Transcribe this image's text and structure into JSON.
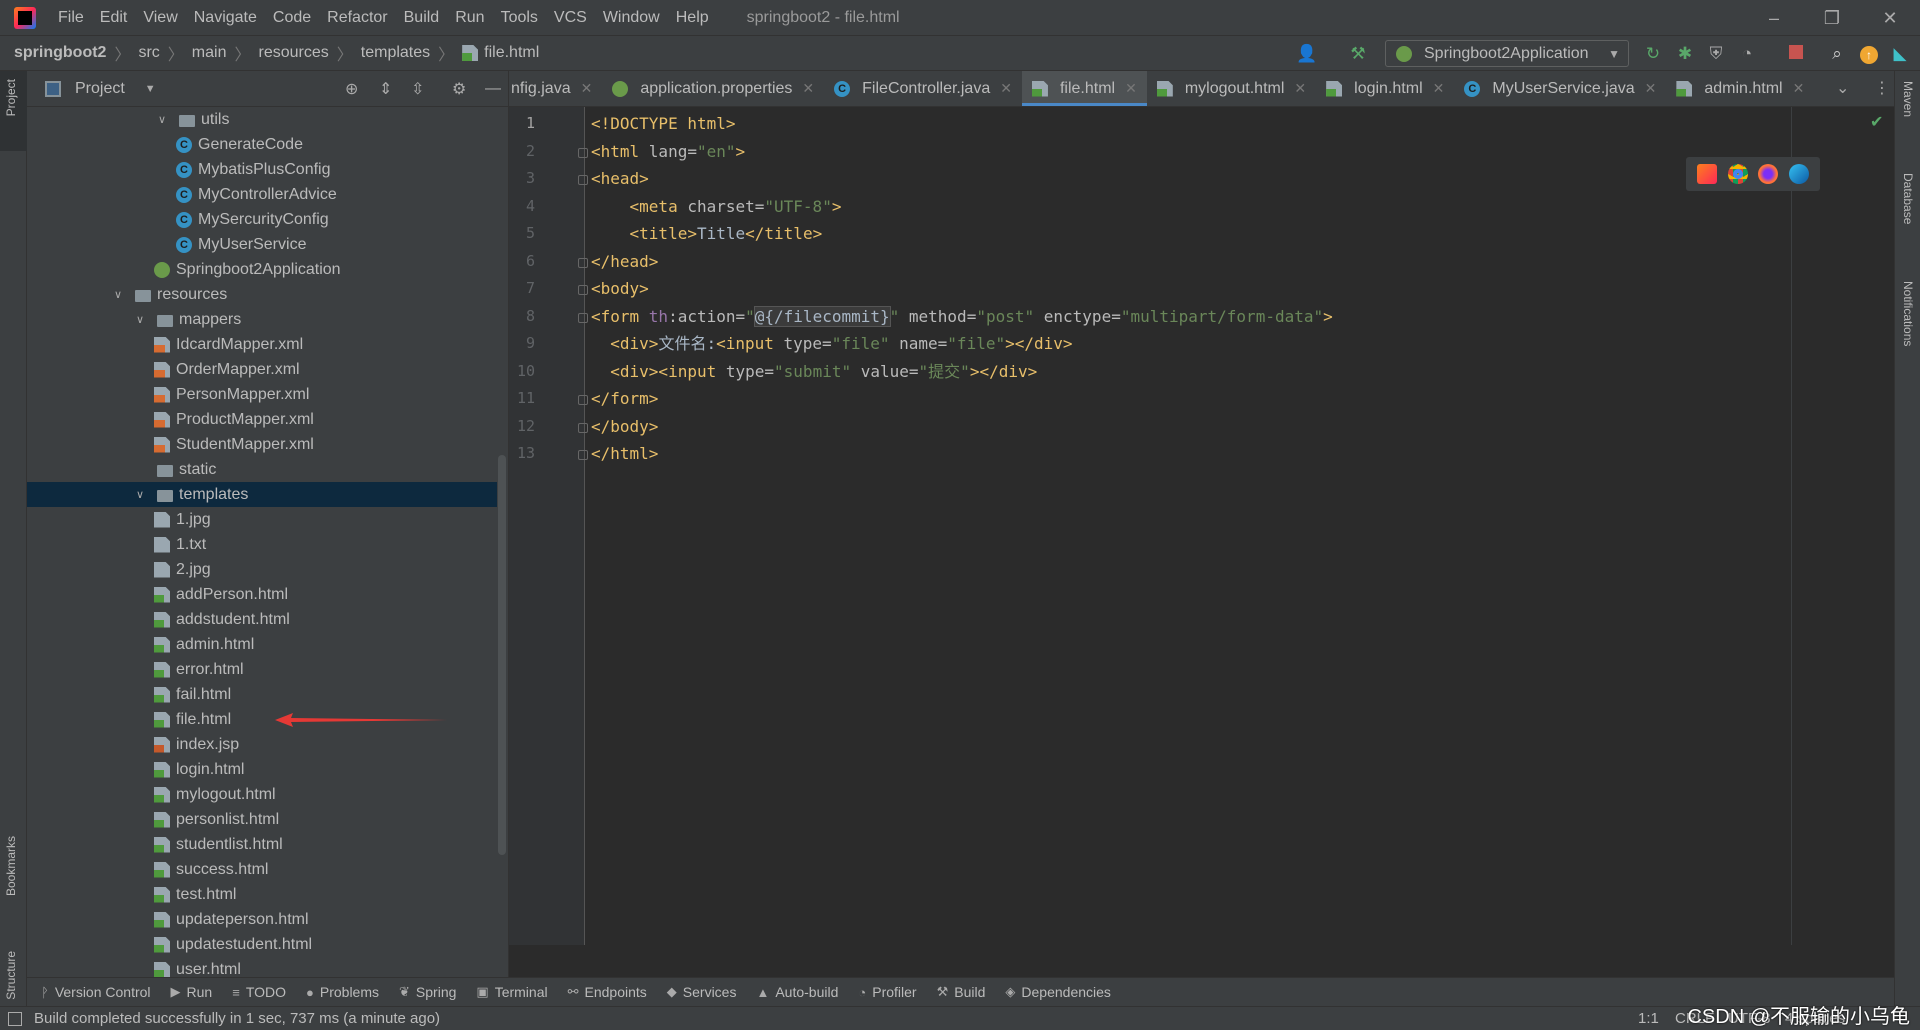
{
  "titlebar": {
    "menu": [
      "File",
      "Edit",
      "View",
      "Navigate",
      "Code",
      "Refactor",
      "Build",
      "Run",
      "Tools",
      "VCS",
      "Window",
      "Help"
    ],
    "title": "springboot2 - file.html"
  },
  "breadcrumb": [
    {
      "label": "springboot2",
      "bold": true
    },
    {
      "label": "src"
    },
    {
      "label": "main"
    },
    {
      "label": "resources"
    },
    {
      "label": "templates"
    },
    {
      "label": "file.html",
      "icon": "html"
    }
  ],
  "run_config": "Springboot2Application",
  "project": {
    "title": "Project",
    "tree": [
      {
        "label": "utils",
        "level": 2,
        "icon": "folder",
        "expanded": true
      },
      {
        "label": "GenerateCode",
        "level": 3,
        "icon": "cls"
      },
      {
        "label": "MybatisPlusConfig",
        "level": 3,
        "icon": "cls"
      },
      {
        "label": "MyControllerAdvice",
        "level": 3,
        "icon": "cls"
      },
      {
        "label": "MySercurityConfig",
        "level": 3,
        "icon": "cls"
      },
      {
        "label": "MyUserService",
        "level": 3,
        "icon": "cls"
      },
      {
        "label": "Springboot2Application",
        "level": 2,
        "icon": "spring"
      },
      {
        "label": "resources",
        "level": 0,
        "icon": "folder",
        "expanded": true
      },
      {
        "label": "mappers",
        "level": 1,
        "icon": "folder",
        "expanded": true
      },
      {
        "label": "IdcardMapper.xml",
        "level": 2,
        "icon": "xml"
      },
      {
        "label": "OrderMapper.xml",
        "level": 2,
        "icon": "xml"
      },
      {
        "label": "PersonMapper.xml",
        "level": 2,
        "icon": "xml"
      },
      {
        "label": "ProductMapper.xml",
        "level": 2,
        "icon": "xml"
      },
      {
        "label": "StudentMapper.xml",
        "level": 2,
        "icon": "xml"
      },
      {
        "label": "static",
        "level": 1,
        "icon": "folder",
        "leaf": true
      },
      {
        "label": "templates",
        "level": 1,
        "icon": "folder",
        "expanded": true,
        "selected": true
      },
      {
        "label": "1.jpg",
        "level": 2,
        "icon": "txt"
      },
      {
        "label": "1.txt",
        "level": 2,
        "icon": "txt"
      },
      {
        "label": "2.jpg",
        "level": 2,
        "icon": "txt"
      },
      {
        "label": "addPerson.html",
        "level": 2,
        "icon": "html"
      },
      {
        "label": "addstudent.html",
        "level": 2,
        "icon": "html"
      },
      {
        "label": "admin.html",
        "level": 2,
        "icon": "html"
      },
      {
        "label": "error.html",
        "level": 2,
        "icon": "html"
      },
      {
        "label": "fail.html",
        "level": 2,
        "icon": "html"
      },
      {
        "label": "file.html",
        "level": 2,
        "icon": "html"
      },
      {
        "label": "index.jsp",
        "level": 2,
        "icon": "jsp"
      },
      {
        "label": "login.html",
        "level": 2,
        "icon": "html"
      },
      {
        "label": "mylogout.html",
        "level": 2,
        "icon": "html"
      },
      {
        "label": "personlist.html",
        "level": 2,
        "icon": "html"
      },
      {
        "label": "studentlist.html",
        "level": 2,
        "icon": "html"
      },
      {
        "label": "success.html",
        "level": 2,
        "icon": "html"
      },
      {
        "label": "test.html",
        "level": 2,
        "icon": "html"
      },
      {
        "label": "updateperson.html",
        "level": 2,
        "icon": "html"
      },
      {
        "label": "updatestudent.html",
        "level": 2,
        "icon": "html"
      },
      {
        "label": "user.html",
        "level": 2,
        "icon": "html"
      }
    ]
  },
  "tabs": [
    {
      "label": "nfig.java",
      "icon": "none"
    },
    {
      "label": "application.properties",
      "icon": "spring"
    },
    {
      "label": "FileController.java",
      "icon": "cls"
    },
    {
      "label": "file.html",
      "icon": "html",
      "active": true
    },
    {
      "label": "mylogout.html",
      "icon": "html"
    },
    {
      "label": "login.html",
      "icon": "html"
    },
    {
      "label": "MyUserService.java",
      "icon": "cls"
    },
    {
      "label": "admin.html",
      "icon": "html"
    }
  ],
  "code": [
    [
      {
        "t": "<!DOCTYPE html>",
        "c": "t"
      }
    ],
    [
      {
        "t": "<html ",
        "c": "t"
      },
      {
        "t": "lang=",
        "c": "a"
      },
      {
        "t": "\"en\"",
        "c": "v"
      },
      {
        "t": ">",
        "c": "t"
      }
    ],
    [
      {
        "t": "<head>",
        "c": "t"
      }
    ],
    [
      {
        "t": "    <meta ",
        "c": "t"
      },
      {
        "t": "charset=",
        "c": "a"
      },
      {
        "t": "\"UTF-8\"",
        "c": "v"
      },
      {
        "t": ">",
        "c": "t"
      }
    ],
    [
      {
        "t": "    <title>",
        "c": "t"
      },
      {
        "t": "Title",
        "c": "p"
      },
      {
        "t": "</title>",
        "c": "t"
      }
    ],
    [
      {
        "t": "</head>",
        "c": "t"
      }
    ],
    [
      {
        "t": "<body>",
        "c": "t"
      }
    ],
    [
      {
        "t": "<form ",
        "c": "t"
      },
      {
        "t": "th",
        "c": "ns"
      },
      {
        "t": ":action=",
        "c": "a"
      },
      {
        "t": "\"",
        "c": "v"
      },
      {
        "t": "@{/filecommit}",
        "c": "hl"
      },
      {
        "t": "\" ",
        "c": "v"
      },
      {
        "t": "method=",
        "c": "a"
      },
      {
        "t": "\"post\" ",
        "c": "v"
      },
      {
        "t": "enctype=",
        "c": "a"
      },
      {
        "t": "\"multipart/form-data\"",
        "c": "v"
      },
      {
        "t": ">",
        "c": "t"
      }
    ],
    [
      {
        "t": "  <div>",
        "c": "t"
      },
      {
        "t": "文件名:",
        "c": "p"
      },
      {
        "t": "<input ",
        "c": "t"
      },
      {
        "t": "type=",
        "c": "a"
      },
      {
        "t": "\"file\" ",
        "c": "v"
      },
      {
        "t": "name=",
        "c": "a"
      },
      {
        "t": "\"file\"",
        "c": "v"
      },
      {
        "t": "></div>",
        "c": "t"
      }
    ],
    [
      {
        "t": "  <div><input ",
        "c": "t"
      },
      {
        "t": "type=",
        "c": "a"
      },
      {
        "t": "\"submit\" ",
        "c": "v"
      },
      {
        "t": "value=",
        "c": "a"
      },
      {
        "t": "\"提交\"",
        "c": "v"
      },
      {
        "t": "></div>",
        "c": "t"
      }
    ],
    [
      {
        "t": "</form>",
        "c": "t"
      }
    ],
    [
      {
        "t": "</body>",
        "c": "t"
      }
    ],
    [
      {
        "t": "</html>",
        "c": "t"
      }
    ]
  ],
  "bottom_tools": [
    {
      "label": "Version Control",
      "icon": "ᚹ"
    },
    {
      "label": "Run",
      "icon": "▶"
    },
    {
      "label": "TODO",
      "icon": "≡"
    },
    {
      "label": "Problems",
      "icon": "●"
    },
    {
      "label": "Spring",
      "icon": "❦"
    },
    {
      "label": "Terminal",
      "icon": "▣"
    },
    {
      "label": "Endpoints",
      "icon": "⚯"
    },
    {
      "label": "Services",
      "icon": "◆"
    },
    {
      "label": "Auto-build",
      "icon": "▲"
    },
    {
      "label": "Profiler",
      "icon": "◔"
    },
    {
      "label": "Build",
      "icon": "⚒"
    },
    {
      "label": "Dependencies",
      "icon": "◈"
    }
  ],
  "left_strip": {
    "top": "Project",
    "bookmarks": "Bookmarks",
    "structure": "Structure"
  },
  "right_strip": {
    "maven": "Maven",
    "database": "Database",
    "notifications": "Notifications"
  },
  "status": {
    "message": "Build completed successfully in 1 sec, 737 ms (a minute ago)",
    "position": "1:1",
    "line_sep": "CRLF",
    "encoding": "UTF-8",
    "indent": "4 spaces"
  },
  "watermark": "CSDN @不服输的小乌龟",
  "colors": {
    "accent": "#4a88c7",
    "selection": "#0d293e",
    "arrow": "#e53935"
  }
}
